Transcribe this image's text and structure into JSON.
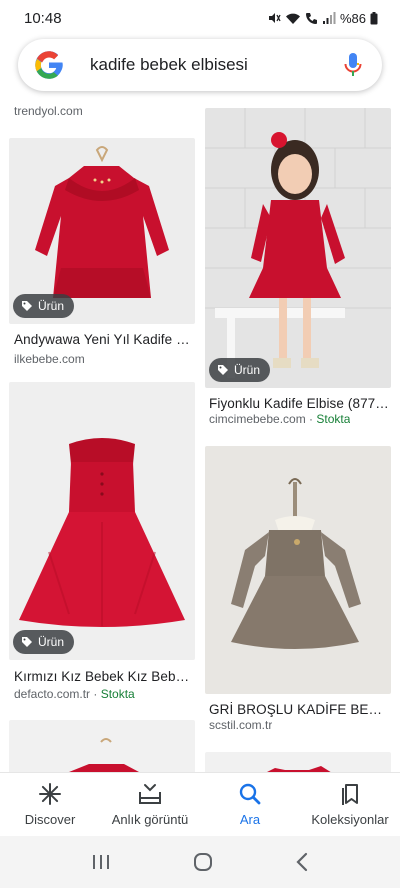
{
  "status_bar": {
    "time": "10:48",
    "battery": "%86"
  },
  "search": {
    "query": "kadife bebek elbisesi"
  },
  "top_source": "trendyol.com",
  "results": [
    {
      "title": "Andywawa Yeni Yıl Kadife Be...",
      "source": "ilkebebe.com",
      "stock": "",
      "badge": "Ürün"
    },
    {
      "title": "Fiyonklu Kadife Elbise (87791...",
      "source": "cimcimebebe.com",
      "stock": "Stokta",
      "badge": "Ürün"
    },
    {
      "title": "Kırmızı Kız Bebek Kız Bebek ...",
      "source": "defacto.com.tr",
      "stock": "Stokta",
      "badge": "Ürün"
    },
    {
      "title": "GRİ BROŞLU KADİFE BEBEK E...",
      "source": "scstil.com.tr",
      "stock": "",
      "badge": ""
    }
  ],
  "bottom_nav": [
    {
      "label": "Discover",
      "icon": "asterisk-icon"
    },
    {
      "label": "Anlık görüntü",
      "icon": "snapshot-icon"
    },
    {
      "label": "Ara",
      "icon": "search-icon"
    },
    {
      "label": "Koleksiyonlar",
      "icon": "collections-icon"
    }
  ],
  "colors": {
    "accent": "#1a73e8",
    "stock_green": "#188038",
    "dress_red": "#c8102e"
  }
}
